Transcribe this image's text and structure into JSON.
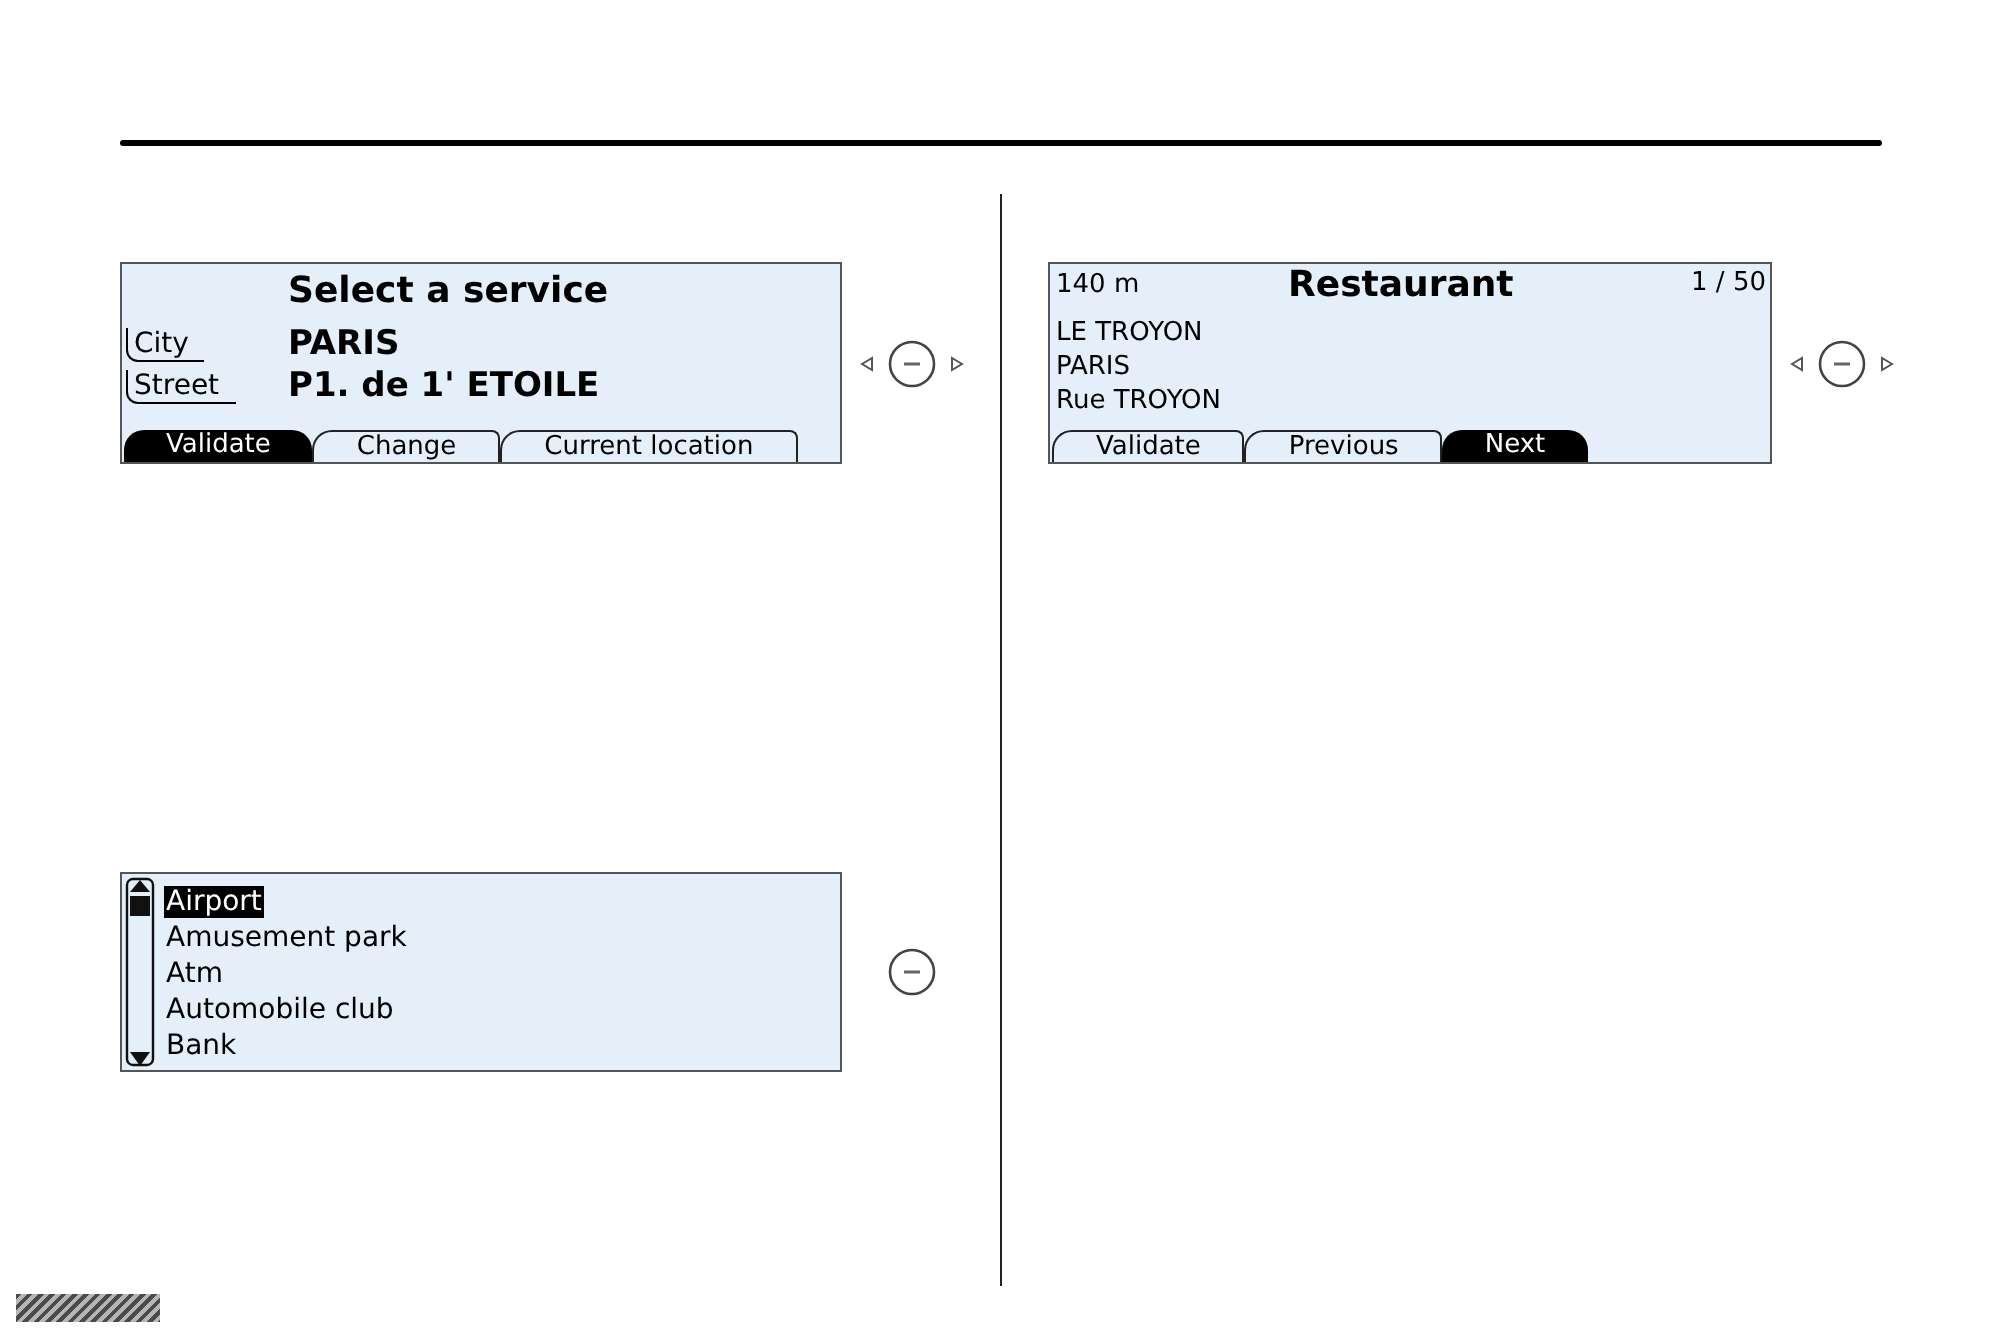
{
  "columns": [
    {
      "screens": [
        {
          "kind": "form",
          "title": "Select a service",
          "fields": [
            {
              "label": "City",
              "value": "PARIS"
            },
            {
              "label": "Street",
              "value": "P1. de 1' ETOILE"
            }
          ],
          "softkeys": [
            {
              "label": "Validate",
              "selected": true
            },
            {
              "label": "Change",
              "selected": false
            },
            {
              "label": "Current location",
              "selected": false
            }
          ],
          "knob": {
            "arrows": true
          }
        },
        {
          "kind": "list",
          "items": [
            {
              "label": "Airport",
              "selected": true
            },
            {
              "label": "Amusement park",
              "selected": false
            },
            {
              "label": "Atm",
              "selected": false
            },
            {
              "label": "Automobile club",
              "selected": false
            },
            {
              "label": "Bank",
              "selected": false
            }
          ],
          "knob": {
            "arrows": false
          }
        }
      ]
    },
    {
      "screens": [
        {
          "kind": "result",
          "distance": "140 m",
          "title": "Restaurant",
          "counter": "1 / 50",
          "lines": [
            "LE TROYON",
            "PARIS",
            "Rue TROYON"
          ],
          "softkeys": [
            {
              "label": "Validate",
              "selected": false
            },
            {
              "label": "Previous",
              "selected": false
            },
            {
              "label": "Next",
              "selected": true
            }
          ],
          "knob": {
            "arrows": true
          }
        }
      ]
    }
  ]
}
